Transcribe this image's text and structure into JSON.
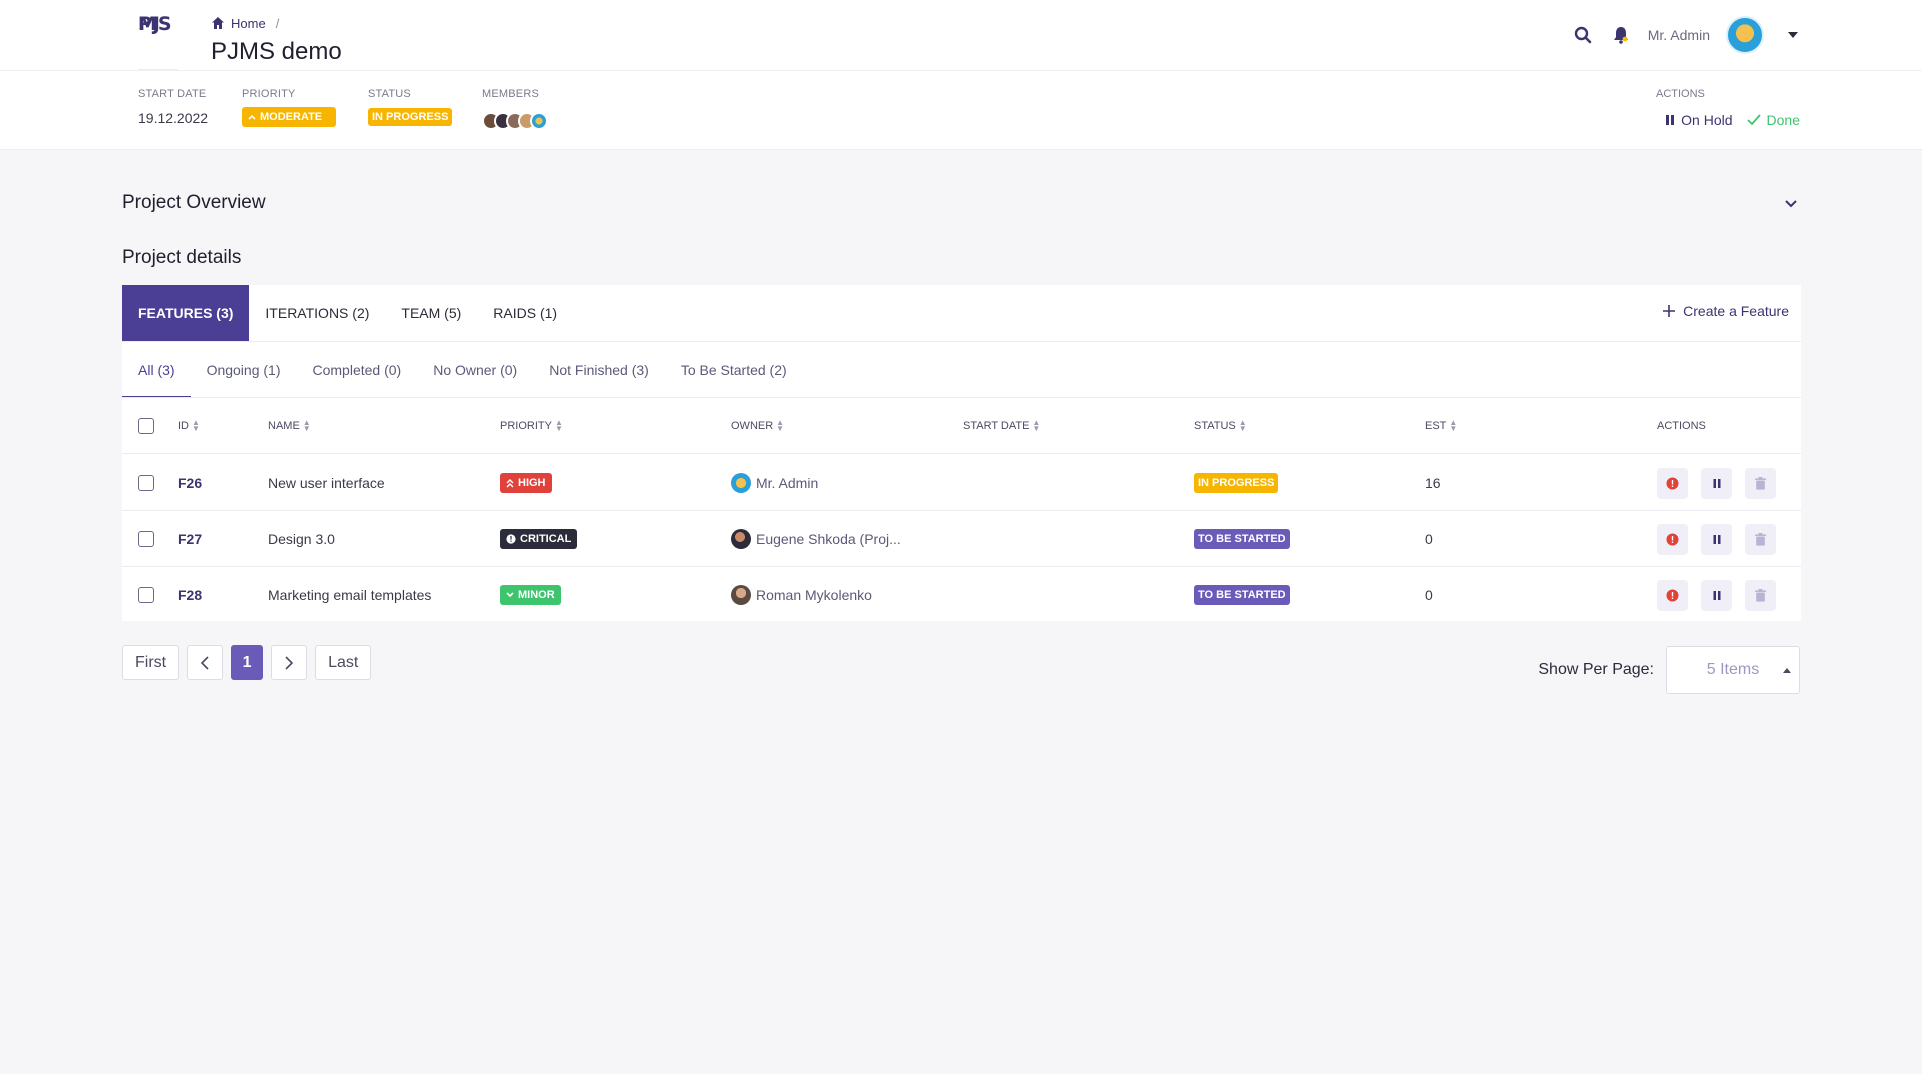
{
  "app": {
    "logo_top": "PJ",
    "logo_bottom": "MS"
  },
  "breadcrumb": {
    "home": "Home",
    "separator": "/"
  },
  "page_title": "PJMS demo",
  "user": {
    "name": "Mr. Admin"
  },
  "meta": {
    "start_date_label": "START DATE",
    "start_date": "19.12.2022",
    "priority_label": "PRIORITY",
    "priority": "MODERATE",
    "status_label": "STATUS",
    "status": "IN PROGRESS",
    "members_label": "MEMBERS",
    "actions_label": "ACTIONS",
    "on_hold": "On Hold",
    "done": "Done"
  },
  "sections": {
    "overview": "Project Overview",
    "details": "Project details"
  },
  "tabs": [
    {
      "label": "FEATURES (3)"
    },
    {
      "label": "ITERATIONS (2)"
    },
    {
      "label": "TEAM (5)"
    },
    {
      "label": "RAIDS (1)"
    }
  ],
  "create_feature": "Create a Feature",
  "subtabs": [
    {
      "label": "All (3)"
    },
    {
      "label": "Ongoing (1)"
    },
    {
      "label": "Completed (0)"
    },
    {
      "label": "No Owner (0)"
    },
    {
      "label": "Not Finished (3)"
    },
    {
      "label": "To Be Started (2)"
    }
  ],
  "columns": {
    "id": "ID",
    "name": "NAME",
    "priority": "PRIORITY",
    "owner": "OWNER",
    "start_date": "START DATE",
    "status": "STATUS",
    "est": "EST",
    "actions": "ACTIONS"
  },
  "rows": [
    {
      "id": "F26",
      "name": "New user interface",
      "priority": "HIGH",
      "owner": "Mr. Admin",
      "start_date": "",
      "status": "IN PROGRESS",
      "est": "16"
    },
    {
      "id": "F27",
      "name": "Design 3.0",
      "priority": "CRITICAL",
      "owner": "Eugene Shkoda (Proj...",
      "start_date": "",
      "status": "TO BE STARTED",
      "est": "0"
    },
    {
      "id": "F28",
      "name": "Marketing email templates",
      "priority": "MINOR",
      "owner": "Roman Mykolenko",
      "start_date": "",
      "status": "TO BE STARTED",
      "est": "0"
    }
  ],
  "pagination": {
    "first": "First",
    "current": "1",
    "last": "Last"
  },
  "per_page": {
    "label": "Show Per Page:",
    "value": "5 Items"
  },
  "colors": {
    "brand": "#4a3f95",
    "accent": "#6a5bb8",
    "warning": "#f7b500",
    "danger": "#e0413a",
    "success": "#3ec46d"
  }
}
